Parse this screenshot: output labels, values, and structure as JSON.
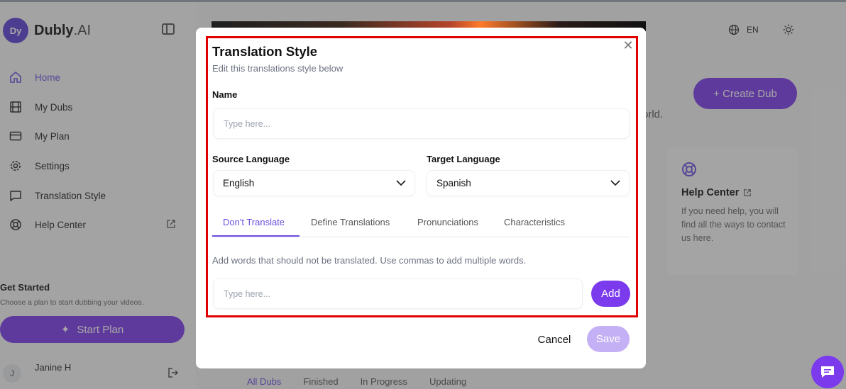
{
  "app": {
    "brand": "Dubly",
    "brand_suffix": ".AI",
    "logo_letters": "Dy"
  },
  "sidebar": {
    "items": [
      {
        "label": "Home",
        "icon": "home-icon"
      },
      {
        "label": "My Dubs",
        "icon": "film-icon"
      },
      {
        "label": "My Plan",
        "icon": "credit-card-icon"
      },
      {
        "label": "Settings",
        "icon": "gear-icon"
      },
      {
        "label": "Translation Style",
        "icon": "chat-icon"
      },
      {
        "label": "Help Center",
        "icon": "lifebuoy-icon"
      }
    ],
    "get_started_title": "Get Started",
    "get_started_sub": "Choose a plan to start dubbing your videos.",
    "start_plan_label": "Start Plan",
    "user_initial": "J",
    "user_name": "Janine H"
  },
  "header": {
    "language": "EN"
  },
  "main": {
    "create_dub_label": "+ Create Dub",
    "partial_text": "orld.",
    "help_card": {
      "title": "Help Center",
      "text": "If you need help, you will find all the ways to contact us here."
    },
    "bottom_tabs": [
      "All Dubs",
      "Finished",
      "In Progress",
      "Updating"
    ]
  },
  "modal": {
    "title": "Translation Style",
    "subtitle": "Edit this translations style below",
    "name_label": "Name",
    "name_placeholder": "Type here...",
    "name_value": "",
    "source_label": "Source Language",
    "source_value": "English",
    "target_label": "Target Language",
    "target_value": "Spanish",
    "tabs": [
      "Don't Translate",
      "Define Translations",
      "Pronunciations",
      "Characteristics"
    ],
    "active_tab": "Don't Translate",
    "hint": "Add words that should not be translated. Use commas to add multiple words.",
    "words_placeholder": "Type here...",
    "add_label": "Add",
    "cancel_label": "Cancel",
    "save_label": "Save"
  },
  "colors": {
    "accent": "#7c3aed",
    "highlight": "#e00000"
  }
}
